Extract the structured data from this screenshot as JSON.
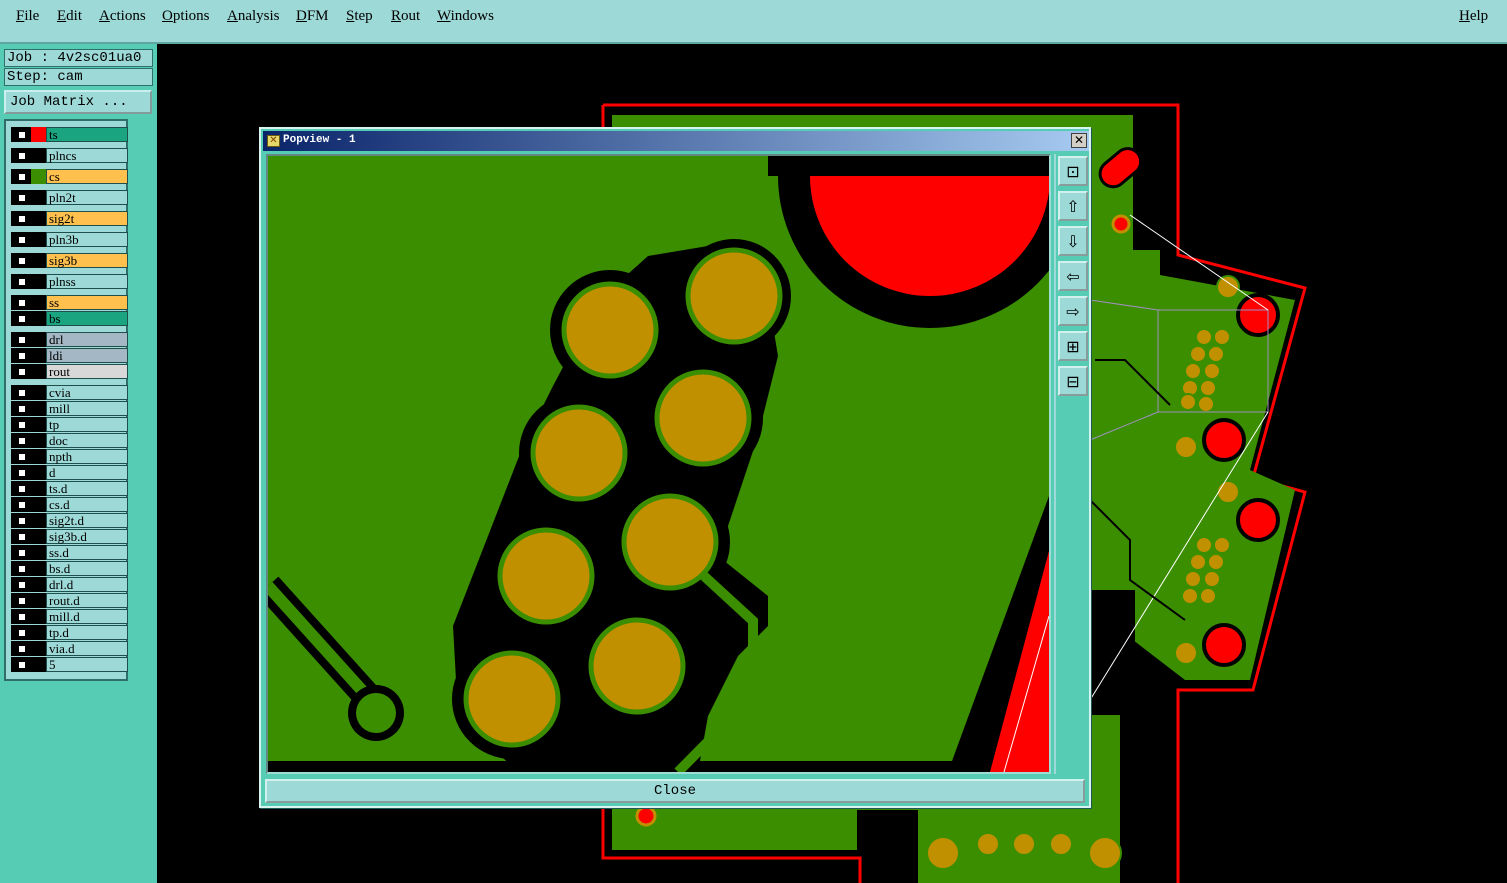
{
  "menubar": {
    "items": [
      "File",
      "Edit",
      "Actions",
      "Options",
      "Analysis",
      "DFM",
      "Step",
      "Rout",
      "Windows"
    ],
    "help": "Help"
  },
  "job_info": {
    "job": "Job : 4v2sc01ua0",
    "step": "Step: cam",
    "job_matrix": "Job Matrix ..."
  },
  "layers": [
    {
      "name": "ts",
      "color": "#1aa47f",
      "swatch": "#ff0000"
    },
    {
      "name": "plncs",
      "color": "#9dd9d6",
      "swatch": "#000000"
    },
    {
      "name": "cs",
      "color": "#ffc04d",
      "swatch": "#3a8e00"
    },
    {
      "name": "pln2t",
      "color": "#9dd9d6",
      "swatch": "#000000"
    },
    {
      "name": "sig2t",
      "color": "#ffc04d",
      "swatch": "#000000"
    },
    {
      "name": "pln3b",
      "color": "#9dd9d6",
      "swatch": "#000000"
    },
    {
      "name": "sig3b",
      "color": "#ffc04d",
      "swatch": "#000000"
    },
    {
      "name": "plnss",
      "color": "#9dd9d6",
      "swatch": "#000000"
    },
    {
      "name": "ss",
      "color": "#ffc04d",
      "swatch": "#000000"
    },
    {
      "name": "bs",
      "color": "#1aa47f",
      "swatch": "#000000"
    },
    {
      "name": "drl",
      "color": "#a3b8c4",
      "swatch": "#000000"
    },
    {
      "name": "ldi",
      "color": "#a3b8c4",
      "swatch": "#000000"
    },
    {
      "name": "rout",
      "color": "#d8d8d8",
      "swatch": "#000000"
    },
    {
      "name": "cvia",
      "color": "#9dd9d6",
      "swatch": "#000000"
    },
    {
      "name": "mill",
      "color": "#9dd9d6",
      "swatch": "#000000"
    },
    {
      "name": "tp",
      "color": "#9dd9d6",
      "swatch": "#000000"
    },
    {
      "name": "doc",
      "color": "#9dd9d6",
      "swatch": "#000000"
    },
    {
      "name": "npth",
      "color": "#9dd9d6",
      "swatch": "#000000"
    },
    {
      "name": "d",
      "color": "#9dd9d6",
      "swatch": "#000000"
    },
    {
      "name": "ts.d",
      "color": "#9dd9d6",
      "swatch": "#000000"
    },
    {
      "name": "cs.d",
      "color": "#9dd9d6",
      "swatch": "#000000"
    },
    {
      "name": "sig2t.d",
      "color": "#9dd9d6",
      "swatch": "#000000"
    },
    {
      "name": "sig3b.d",
      "color": "#9dd9d6",
      "swatch": "#000000"
    },
    {
      "name": "ss.d",
      "color": "#9dd9d6",
      "swatch": "#000000"
    },
    {
      "name": "bs.d",
      "color": "#9dd9d6",
      "swatch": "#000000"
    },
    {
      "name": "drl.d",
      "color": "#9dd9d6",
      "swatch": "#000000"
    },
    {
      "name": "rout.d",
      "color": "#9dd9d6",
      "swatch": "#000000"
    },
    {
      "name": "mill.d",
      "color": "#9dd9d6",
      "swatch": "#000000"
    },
    {
      "name": "tp.d",
      "color": "#9dd9d6",
      "swatch": "#000000"
    },
    {
      "name": "via.d",
      "color": "#9dd9d6",
      "swatch": "#000000"
    },
    {
      "name": "5",
      "color": "#9dd9d6",
      "swatch": "#000000"
    }
  ],
  "popview": {
    "title": "Popview - 1",
    "close_label": "Close",
    "tools": [
      "zoom-fit-icon",
      "pan-up-icon",
      "pan-down-icon",
      "pan-left-icon",
      "pan-right-icon",
      "zoom-in-icon",
      "zoom-out-icon"
    ]
  },
  "colors": {
    "board_green": "#3a8e00",
    "copper_pad": "#c09000",
    "pad_red": "#ff0000",
    "panel_cyan": "#9dd9d6",
    "panel_teal": "#55ccb3"
  }
}
